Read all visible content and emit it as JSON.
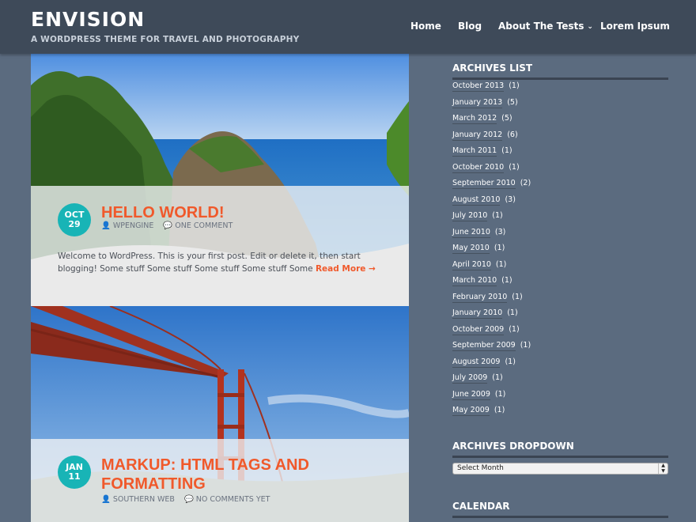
{
  "header": {
    "site_title": "ENVISION",
    "site_description": "A WORDPRESS THEME FOR TRAVEL AND PHOTOGRAPHY",
    "nav": {
      "home": "Home",
      "blog": "Blog",
      "about": "About The Tests",
      "lorem": "Lorem Ipsum"
    }
  },
  "posts": [
    {
      "month": "OCT",
      "day": "29",
      "title": "HELLO WORLD!",
      "author": "WPENGINE",
      "comments": "ONE COMMENT",
      "excerpt": "Welcome to WordPress. This is your first post. Edit or delete it, then start blogging!   Some stuff Some stuff Some stuff Some stuff Some",
      "read_more": "Read More →"
    },
    {
      "month": "JAN",
      "day": "11",
      "title_line1": "MARKUP: HTML TAGS AND",
      "title_line2": "FORMATTING",
      "author": "SOUTHERN WEB",
      "comments": "NO COMMENTS YET"
    }
  ],
  "sidebar": {
    "archives_title": "ARCHIVES LIST",
    "archives": [
      {
        "label": "October 2013",
        "count": "(1)"
      },
      {
        "label": "January 2013",
        "count": "(5)"
      },
      {
        "label": "March 2012",
        "count": "(5)"
      },
      {
        "label": "January 2012",
        "count": "(6)"
      },
      {
        "label": "March 2011",
        "count": "(1)"
      },
      {
        "label": "October 2010",
        "count": "(1)"
      },
      {
        "label": "September 2010",
        "count": "(2)"
      },
      {
        "label": "August 2010",
        "count": "(3)"
      },
      {
        "label": "July 2010",
        "count": "(1)"
      },
      {
        "label": "June 2010",
        "count": "(3)"
      },
      {
        "label": "May 2010",
        "count": "(1)"
      },
      {
        "label": "April 2010",
        "count": "(1)"
      },
      {
        "label": "March 2010",
        "count": "(1)"
      },
      {
        "label": "February 2010",
        "count": "(1)"
      },
      {
        "label": "January 2010",
        "count": "(1)"
      },
      {
        "label": "October 2009",
        "count": "(1)"
      },
      {
        "label": "September 2009",
        "count": "(1)"
      },
      {
        "label": "August 2009",
        "count": "(1)"
      },
      {
        "label": "July 2009",
        "count": "(1)"
      },
      {
        "label": "June 2009",
        "count": "(1)"
      },
      {
        "label": "May 2009",
        "count": "(1)"
      }
    ],
    "dropdown_title": "ARCHIVES DROPDOWN",
    "dropdown_value": "Select Month",
    "calendar_title": "CALENDAR"
  },
  "colors": {
    "accent": "#f0592b",
    "badge": "#18b4b6",
    "header_bg": "#3e4a59",
    "page_bg": "#5b6b7f"
  }
}
